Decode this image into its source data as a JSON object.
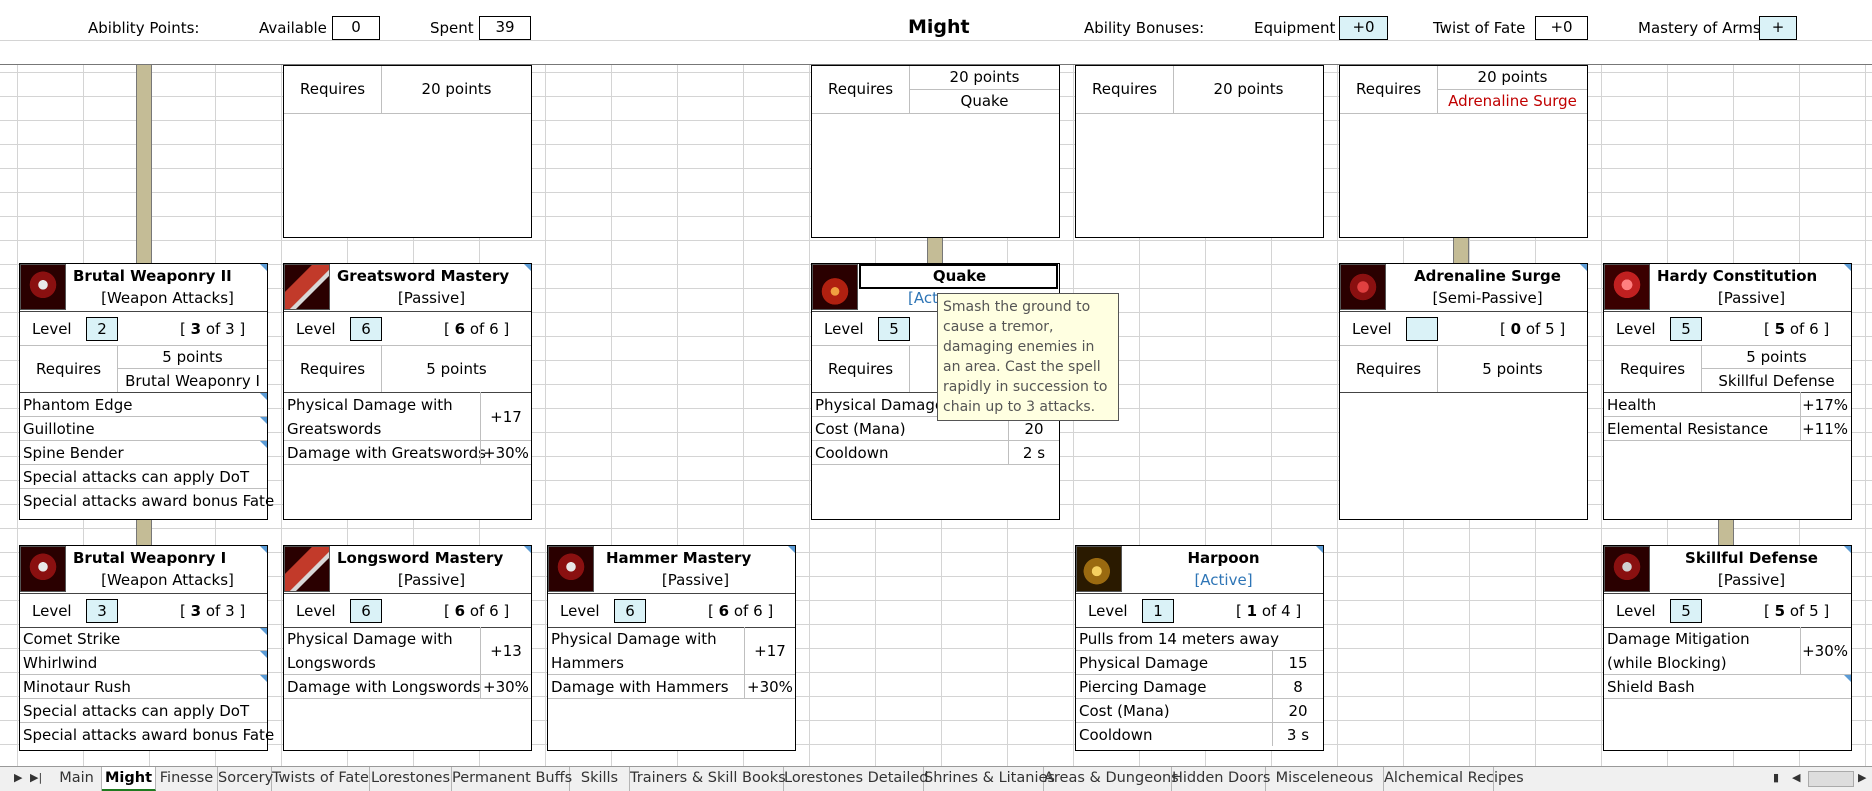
{
  "header": {
    "ability_points_label": "Abiblity Points:",
    "available_label": "Available",
    "available_value": "0",
    "spent_label": "Spent",
    "spent_value": "39",
    "title": "Might",
    "ability_bonuses_label": "Ability Bonuses:",
    "equipment_label": "Equipment",
    "equipment_value": "+0",
    "twist_label": "Twist of Fate",
    "twist_value": "+0",
    "mastery_label": "Mastery of Arms",
    "mastery_value": "+"
  },
  "common": {
    "level": "Level",
    "requires": "Requires",
    "of": "of",
    "points_20": "20 points",
    "points_5": "5 points"
  },
  "top_cards": {
    "greatsword_req": "20 points",
    "quake_req_pts": "20 points",
    "quake_req_name": "Quake",
    "harpoon_req": "20 points",
    "adrenaline_req_pts": "20 points",
    "adrenaline_req_name": "Adrenaline Surge"
  },
  "cards": {
    "bw2": {
      "name": "Brutal Weaponry II",
      "type": "[Weapon Attacks]",
      "level": "2",
      "cur": "3",
      "max": "3",
      "req_pts": "5 points",
      "req_name": "Brutal Weaponry I",
      "items": [
        "Phantom Edge",
        "Guillotine",
        "Spine Bender",
        "Special attacks can apply DoT",
        "Special attacks award bonus Fate"
      ]
    },
    "gsm": {
      "name": "Greatsword Mastery",
      "type": "[Passive]",
      "level": "6",
      "cur": "6",
      "max": "6",
      "req_pts": "5 points",
      "s1_a": "Physical Damage with",
      "s1_b": "Greatswords",
      "s1_v": "+17",
      "s2": "Damage with Greatswords",
      "s2_v": "+30%"
    },
    "quake": {
      "name": "Quake",
      "type": "[Active]",
      "type_partial": "[Act",
      "level": "5",
      "s1": "Physical Damage",
      "s2": "Cost (Mana)",
      "s2_v": "20",
      "s3": "Cooldown",
      "s3_v": "2 s",
      "tooltip": "Smash the ground to cause a tremor, damaging enemies in an area. Cast the spell rapidly in succession to chain up to 3 attacks."
    },
    "as": {
      "name": "Adrenaline Surge",
      "type": "[Semi-Passive]",
      "level": "",
      "cur": "0",
      "max": "5",
      "req_pts": "5 points"
    },
    "hc": {
      "name": "Hardy Constitution",
      "type": "[Passive]",
      "level": "5",
      "cur": "5",
      "max": "6",
      "req_pts": "5 points",
      "req_name": "Skillful Defense",
      "s1": "Health",
      "s1_v": "+17%",
      "s2": "Elemental Resistance",
      "s2_v": "+11%"
    },
    "bw1": {
      "name": "Brutal Weaponry I",
      "type": "[Weapon Attacks]",
      "level": "3",
      "cur": "3",
      "max": "3",
      "items": [
        "Comet Strike",
        "Whirlwind",
        "Minotaur Rush",
        "Special attacks can apply DoT",
        "Special attacks award bonus Fate"
      ]
    },
    "lsm": {
      "name": "Longsword Mastery",
      "type": "[Passive]",
      "level": "6",
      "cur": "6",
      "max": "6",
      "s1_a": "Physical Damage with",
      "s1_b": "Longswords",
      "s1_v": "+13",
      "s2": "Damage with Longswords",
      "s2_v": "+30%"
    },
    "hm": {
      "name": "Hammer Mastery",
      "type": "[Passive]",
      "level": "6",
      "cur": "6",
      "max": "6",
      "s1_a": "Physical Damage with",
      "s1_b": "Hammers",
      "s1_v": "+17",
      "s2": "Damage with Hammers",
      "s2_v": "+30%"
    },
    "hp": {
      "name": "Harpoon",
      "type": "[Active]",
      "level": "1",
      "cur": "1",
      "max": "4",
      "desc": "Pulls from 14 meters away",
      "s1": "Physical Damage",
      "s1_v": "15",
      "s2": "Piercing Damage",
      "s2_v": "8",
      "s3": "Cost (Mana)",
      "s3_v": "20",
      "s4": "Cooldown",
      "s4_v": "3 s"
    },
    "sd": {
      "name": "Skillful Defense",
      "type": "[Passive]",
      "level": "5",
      "cur": "5",
      "max": "5",
      "s1_a": "Damage Mitigation",
      "s1_b": "(while Blocking)",
      "s1_v": "+30%",
      "s2": "Shield Bash"
    }
  },
  "tabs": [
    "Main",
    "Might",
    "Finesse",
    "Sorcery",
    "Twists of Fate",
    "Lorestones",
    "Permanent Buffs",
    "Skills",
    "Trainers & Skill Books",
    "Lorestones Detailed",
    "Shrines & Litanies",
    "Areas & Dungeons",
    "Hidden Doors",
    "Misceleneous",
    "Alchemical Recipes"
  ],
  "active_tab": "Might",
  "colors": {
    "cyan_cell": "#daf2f7",
    "connector": "#c4bc96",
    "red_text": "#c00000",
    "blue_text": "#2e75b6",
    "tooltip_bg": "#ffffe1"
  }
}
